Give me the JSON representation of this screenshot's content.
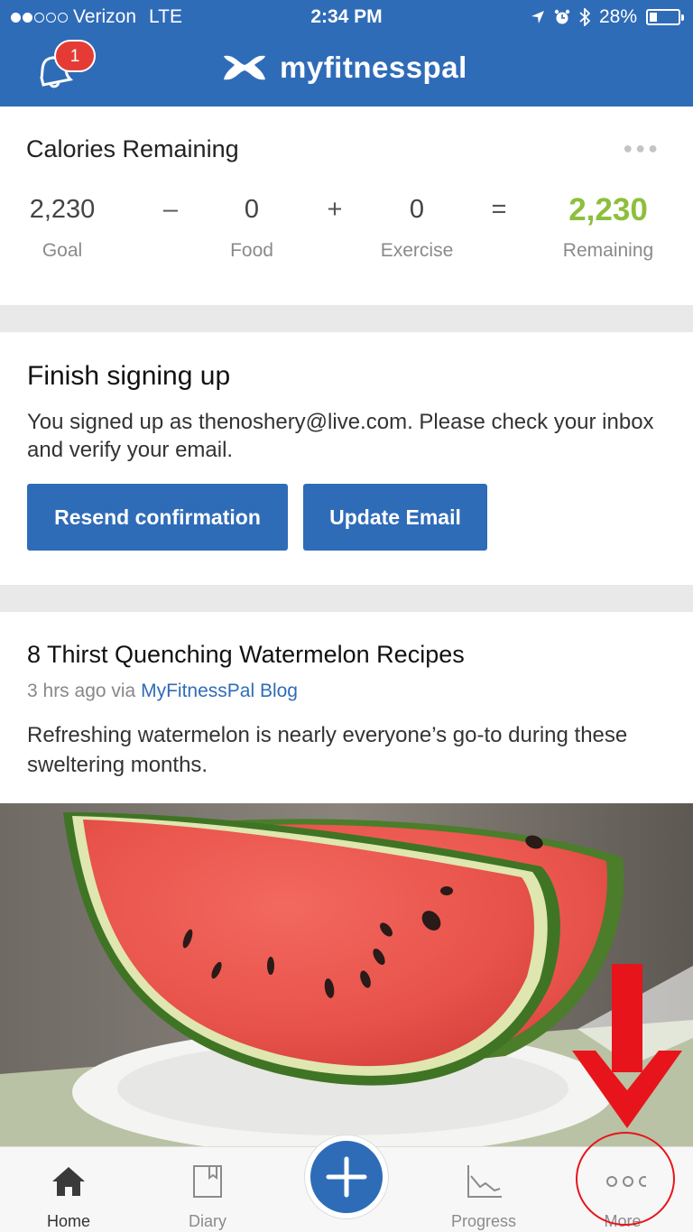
{
  "status": {
    "carrier": "Verizon",
    "network": "LTE",
    "time": "2:34 PM",
    "battery": "28%",
    "battery_level": 0.28,
    "signal_bars": 2
  },
  "header": {
    "brand": "myfitnesspal",
    "notification_count": "1"
  },
  "calories": {
    "title": "Calories Remaining",
    "goal_value": "2,230",
    "goal_label": "Goal",
    "minus": "–",
    "food_value": "0",
    "food_label": "Food",
    "plus": "+",
    "exercise_value": "0",
    "exercise_label": "Exercise",
    "equals": "=",
    "remaining_value": "2,230",
    "remaining_label": "Remaining",
    "accent": "#8dbf3d"
  },
  "signup": {
    "title": "Finish signing up",
    "message": "You signed up as thenoshery@live.com. Please check your inbox and verify your email.",
    "resend_label": "Resend confirmation",
    "update_label": "Update Email"
  },
  "article": {
    "title": "8 Thirst Quenching Watermelon Recipes",
    "time_ago": "3 hrs ago via ",
    "source": "MyFitnessPal Blog",
    "summary": "Refreshing watermelon is nearly everyone’s go-to during these sweltering months."
  },
  "tabs": [
    {
      "label": "Home",
      "icon": "home-icon"
    },
    {
      "label": "Diary",
      "icon": "diary-icon"
    },
    {
      "label": "Progress",
      "icon": "progress-icon"
    },
    {
      "label": "More",
      "icon": "more-icon"
    }
  ],
  "colors": {
    "brand_blue": "#2f6cb8",
    "badge_red": "#e43c35",
    "annotation_red": "#e8141c"
  }
}
